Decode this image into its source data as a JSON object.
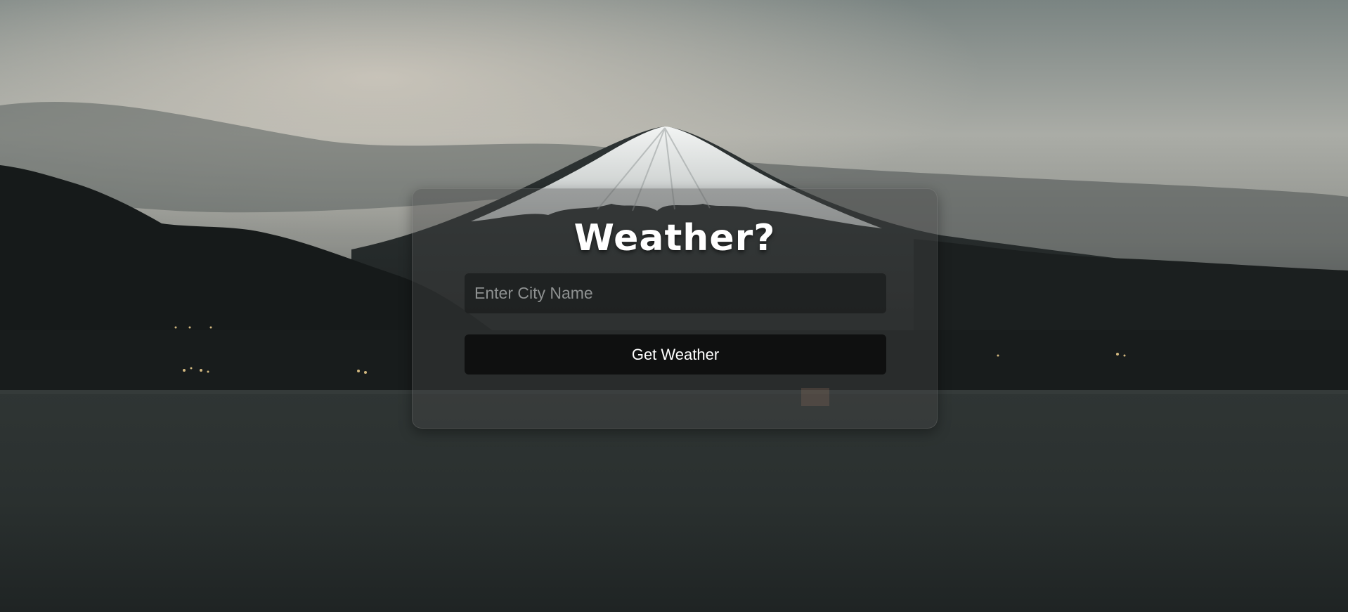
{
  "app": {
    "title": "Weather?"
  },
  "search": {
    "value": "",
    "placeholder": "Enter City Name"
  },
  "actions": {
    "get_weather_label": "Get Weather"
  },
  "background": {
    "scene": "mountain-lake-dusk",
    "colors": {
      "sky_top": "#7d8685",
      "sky_glow": "#c2bcb3",
      "snow": "#eef0ef",
      "mountain": "#1e2222",
      "water": "#2a2f2e"
    }
  }
}
